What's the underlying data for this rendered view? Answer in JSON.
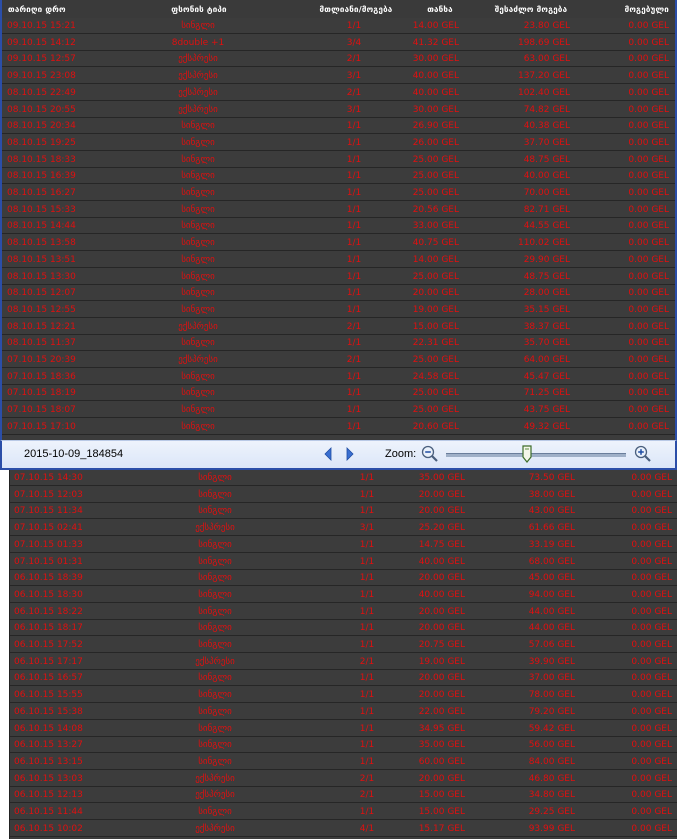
{
  "headers": {
    "date": "თარიღი დრო",
    "type": "ფსონის ტიპი",
    "combination": "მთლიანი/მოგება",
    "amount": "თანხა",
    "possible_win": "შესაძლო მოგება",
    "win": "მოგებული"
  },
  "viewer": {
    "image_name": "2015-10-09_184854",
    "zoom_label": "Zoom:",
    "zoom_level": 0.45,
    "prev_icon": "chevron-left-icon",
    "next_icon": "chevron-right-icon",
    "zoom_out_icon": "zoom-out-icon",
    "zoom_in_icon": "zoom-in-icon"
  },
  "colors": {
    "row_text": "#e01010",
    "row_bg": "#3c3c3c",
    "header_text": "#ffffff",
    "frame": "#2b4ea8"
  },
  "rows_top": [
    {
      "date": "09.10.15 15:21",
      "type": "სინგლი",
      "comb": "1/1",
      "amount": "14.00 GEL",
      "pwin": "23.80 GEL",
      "win": "0.00 GEL"
    },
    {
      "date": "09.10.15 14:12",
      "type": "8double +1",
      "comb": "3/4",
      "amount": "41.32 GEL",
      "pwin": "198.69 GEL",
      "win": "0.00 GEL"
    },
    {
      "date": "09.10.15 12:57",
      "type": "ექსპრესი",
      "comb": "2/1",
      "amount": "30.00 GEL",
      "pwin": "63.00 GEL",
      "win": "0.00 GEL"
    },
    {
      "date": "09.10.15 23:08",
      "type": "ექსპრესი",
      "comb": "3/1",
      "amount": "40.00 GEL",
      "pwin": "137.20 GEL",
      "win": "0.00 GEL"
    },
    {
      "date": "08.10.15 22:49",
      "type": "ექსპრესი",
      "comb": "2/1",
      "amount": "40.00 GEL",
      "pwin": "102.40 GEL",
      "win": "0.00 GEL"
    },
    {
      "date": "08.10.15 20:55",
      "type": "ექსპრესი",
      "comb": "3/1",
      "amount": "30.00 GEL",
      "pwin": "74.82 GEL",
      "win": "0.00 GEL"
    },
    {
      "date": "08.10.15 20:34",
      "type": "სინგლი",
      "comb": "1/1",
      "amount": "26.90 GEL",
      "pwin": "40.38 GEL",
      "win": "0.00 GEL"
    },
    {
      "date": "08.10.15 19:25",
      "type": "სინგლი",
      "comb": "1/1",
      "amount": "26.00 GEL",
      "pwin": "37.70 GEL",
      "win": "0.00 GEL"
    },
    {
      "date": "08.10.15 18:33",
      "type": "სინგლი",
      "comb": "1/1",
      "amount": "25.00 GEL",
      "pwin": "48.75 GEL",
      "win": "0.00 GEL"
    },
    {
      "date": "08.10.15 16:39",
      "type": "სინგლი",
      "comb": "1/1",
      "amount": "25.00 GEL",
      "pwin": "40.00 GEL",
      "win": "0.00 GEL"
    },
    {
      "date": "08.10.15 16:27",
      "type": "სინგლი",
      "comb": "1/1",
      "amount": "25.00 GEL",
      "pwin": "70.00 GEL",
      "win": "0.00 GEL"
    },
    {
      "date": "08.10.15 15:33",
      "type": "სინგლი",
      "comb": "1/1",
      "amount": "20.56 GEL",
      "pwin": "82.71 GEL",
      "win": "0.00 GEL"
    },
    {
      "date": "08.10.15 14:44",
      "type": "სინგლი",
      "comb": "1/1",
      "amount": "33.00 GEL",
      "pwin": "44.55 GEL",
      "win": "0.00 GEL"
    },
    {
      "date": "08.10.15 13:58",
      "type": "სინგლი",
      "comb": "1/1",
      "amount": "40.75 GEL",
      "pwin": "110.02 GEL",
      "win": "0.00 GEL"
    },
    {
      "date": "08.10.15 13:51",
      "type": "სინგლი",
      "comb": "1/1",
      "amount": "14.00 GEL",
      "pwin": "29.90 GEL",
      "win": "0.00 GEL"
    },
    {
      "date": "08.10.15 13:30",
      "type": "სინგლი",
      "comb": "1/1",
      "amount": "25.00 GEL",
      "pwin": "48.75 GEL",
      "win": "0.00 GEL"
    },
    {
      "date": "08.10.15 12:07",
      "type": "სინგლი",
      "comb": "1/1",
      "amount": "20.00 GEL",
      "pwin": "28.00 GEL",
      "win": "0.00 GEL"
    },
    {
      "date": "08.10.15 12:55",
      "type": "სინგლი",
      "comb": "1/1",
      "amount": "19.00 GEL",
      "pwin": "35.15 GEL",
      "win": "0.00 GEL"
    },
    {
      "date": "08.10.15 12:21",
      "type": "ექსპრესი",
      "comb": "2/1",
      "amount": "15.00 GEL",
      "pwin": "38.37 GEL",
      "win": "0.00 GEL"
    },
    {
      "date": "08.10.15 11:37",
      "type": "სინგლი",
      "comb": "1/1",
      "amount": "22.31 GEL",
      "pwin": "35.70 GEL",
      "win": "0.00 GEL"
    },
    {
      "date": "07.10.15 20:39",
      "type": "ექსპრესი",
      "comb": "2/1",
      "amount": "25.00 GEL",
      "pwin": "64.00 GEL",
      "win": "0.00 GEL"
    },
    {
      "date": "07.10.15 18:36",
      "type": "სინგლი",
      "comb": "1/1",
      "amount": "24.58 GEL",
      "pwin": "45.47 GEL",
      "win": "0.00 GEL"
    },
    {
      "date": "07.10.15 18:19",
      "type": "სინგლი",
      "comb": "1/1",
      "amount": "25.00 GEL",
      "pwin": "71.25 GEL",
      "win": "0.00 GEL"
    },
    {
      "date": "07.10.15 18:07",
      "type": "სინგლი",
      "comb": "1/1",
      "amount": "25.00 GEL",
      "pwin": "43.75 GEL",
      "win": "0.00 GEL"
    },
    {
      "date": "07.10.15 17:10",
      "type": "სინგლი",
      "comb": "1/1",
      "amount": "20.60 GEL",
      "pwin": "49.32 GEL",
      "win": "0.00 GEL"
    }
  ],
  "rows_bottom": [
    {
      "date": "07.10.15 14:30",
      "type": "სინგლი",
      "comb": "1/1",
      "amount": "35.00 GEL",
      "pwin": "73.50 GEL",
      "win": "0.00 GEL"
    },
    {
      "date": "07.10.15 12:03",
      "type": "სინგლი",
      "comb": "1/1",
      "amount": "20.00 GEL",
      "pwin": "38.00 GEL",
      "win": "0.00 GEL"
    },
    {
      "date": "07.10.15 11:34",
      "type": "სინგლი",
      "comb": "1/1",
      "amount": "20.00 GEL",
      "pwin": "43.00 GEL",
      "win": "0.00 GEL"
    },
    {
      "date": "07.10.15 02:41",
      "type": "ექსპრესი",
      "comb": "3/1",
      "amount": "25.20 GEL",
      "pwin": "61.66 GEL",
      "win": "0.00 GEL"
    },
    {
      "date": "07.10.15 01:33",
      "type": "სინგლი",
      "comb": "1/1",
      "amount": "14.75 GEL",
      "pwin": "33.19 GEL",
      "win": "0.00 GEL"
    },
    {
      "date": "07.10.15 01:31",
      "type": "სინგლი",
      "comb": "1/1",
      "amount": "40.00 GEL",
      "pwin": "68.00 GEL",
      "win": "0.00 GEL"
    },
    {
      "date": "06.10.15 18:39",
      "type": "სინგლი",
      "comb": "1/1",
      "amount": "20.00 GEL",
      "pwin": "45.00 GEL",
      "win": "0.00 GEL"
    },
    {
      "date": "06.10.15 18:30",
      "type": "სინგლი",
      "comb": "1/1",
      "amount": "40.00 GEL",
      "pwin": "94.00 GEL",
      "win": "0.00 GEL"
    },
    {
      "date": "06.10.15 18:22",
      "type": "სინგლი",
      "comb": "1/1",
      "amount": "20.00 GEL",
      "pwin": "44.00 GEL",
      "win": "0.00 GEL"
    },
    {
      "date": "06.10.15 18:17",
      "type": "სინგლი",
      "comb": "1/1",
      "amount": "20.00 GEL",
      "pwin": "44.00 GEL",
      "win": "0.00 GEL"
    },
    {
      "date": "06.10.15 17:52",
      "type": "სინგლი",
      "comb": "1/1",
      "amount": "20.75 GEL",
      "pwin": "57.06 GEL",
      "win": "0.00 GEL"
    },
    {
      "date": "06.10.15 17:17",
      "type": "ექსპრესი",
      "comb": "2/1",
      "amount": "19.00 GEL",
      "pwin": "39.90 GEL",
      "win": "0.00 GEL"
    },
    {
      "date": "06.10.15 16:57",
      "type": "სინგლი",
      "comb": "1/1",
      "amount": "20.00 GEL",
      "pwin": "37.00 GEL",
      "win": "0.00 GEL"
    },
    {
      "date": "06.10.15 15:55",
      "type": "სინგლი",
      "comb": "1/1",
      "amount": "20.00 GEL",
      "pwin": "78.00 GEL",
      "win": "0.00 GEL"
    },
    {
      "date": "06.10.15 15:38",
      "type": "სინგლი",
      "comb": "1/1",
      "amount": "22.00 GEL",
      "pwin": "79.20 GEL",
      "win": "0.00 GEL"
    },
    {
      "date": "06.10.15 14:08",
      "type": "სინგლი",
      "comb": "1/1",
      "amount": "34.95 GEL",
      "pwin": "59.42 GEL",
      "win": "0.00 GEL"
    },
    {
      "date": "06.10.15 13:27",
      "type": "სინგლი",
      "comb": "1/1",
      "amount": "35.00 GEL",
      "pwin": "56.00 GEL",
      "win": "0.00 GEL"
    },
    {
      "date": "06.10.15 13:15",
      "type": "სინგლი",
      "comb": "1/1",
      "amount": "60.00 GEL",
      "pwin": "84.00 GEL",
      "win": "0.00 GEL"
    },
    {
      "date": "06.10.15 13:03",
      "type": "ექსპრესი",
      "comb": "2/1",
      "amount": "20.00 GEL",
      "pwin": "46.80 GEL",
      "win": "0.00 GEL"
    },
    {
      "date": "06.10.15 12:13",
      "type": "ექსპრესი",
      "comb": "2/1",
      "amount": "15.00 GEL",
      "pwin": "34.80 GEL",
      "win": "0.00 GEL"
    },
    {
      "date": "06.10.15 11:44",
      "type": "სინგლი",
      "comb": "1/1",
      "amount": "15.00 GEL",
      "pwin": "29.25 GEL",
      "win": "0.00 GEL"
    },
    {
      "date": "06.10.15 10:02",
      "type": "ექსპრესი",
      "comb": "4/1",
      "amount": "15.17 GEL",
      "pwin": "93.99 GEL",
      "win": "0.00 GEL"
    }
  ]
}
